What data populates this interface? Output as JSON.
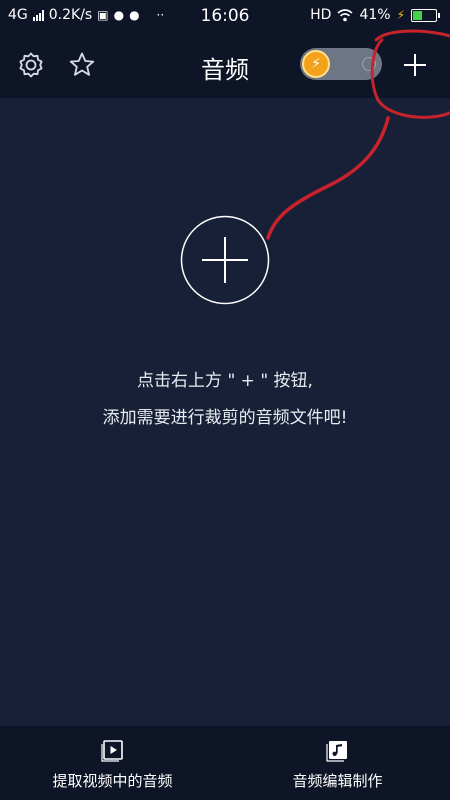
{
  "status_bar": {
    "network": "4G",
    "speed": "0.2K/s",
    "time": "16:06",
    "hd": "HD",
    "battery": "41%",
    "battery_level": 0.41
  },
  "header": {
    "title": "音频",
    "settings_icon": "gear-icon",
    "favorite_icon": "star-icon",
    "speed_icon": "lightning-icon",
    "add_icon": "plus-icon"
  },
  "main": {
    "add_icon": "circle-plus-icon",
    "hint_line1": "点击右上方 \" + \" 按钮,",
    "hint_line2": "添加需要进行裁剪的音频文件吧!"
  },
  "bottom_bar": {
    "extract_label": "提取视频中的音频",
    "edit_label": "音频编辑制作",
    "extract_icon": "video-play-icon",
    "edit_icon": "music-note-icon"
  },
  "colors": {
    "background": "#172037",
    "bar": "#0e1526",
    "annotation": "#c8232c",
    "accent": "#f2a11a",
    "battery": "#44d24a"
  }
}
